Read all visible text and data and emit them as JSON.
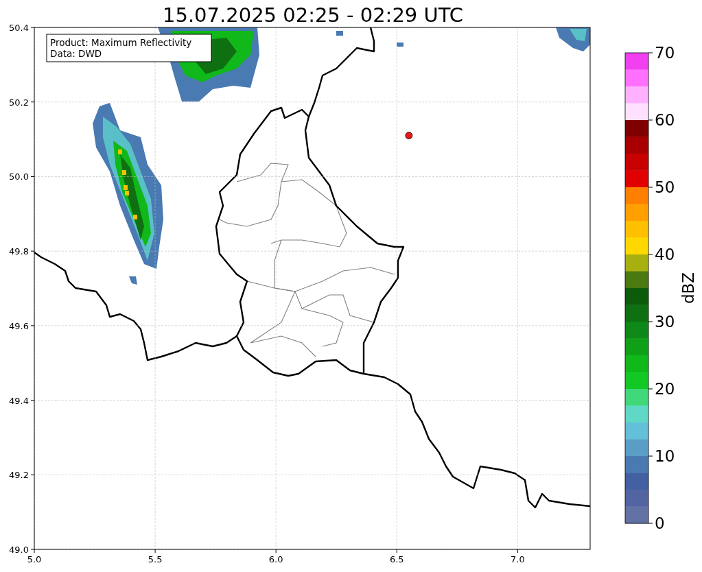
{
  "chart": {
    "info": [
      "Product: Maximum Reflectivity",
      "Data: DWD"
    ],
    "chart_data": {
      "type": "scatter",
      "title": "15.07.2025 02:25 - 02:29 UTC",
      "xlim": [
        5,
        7.3
      ],
      "ylim": [
        49,
        50.4
      ],
      "xticks": [
        {
          "value": 5,
          "label": "5.0"
        },
        {
          "value": 5.5,
          "label": "5.5"
        },
        {
          "value": 6,
          "label": "6.0"
        },
        {
          "value": 6.5,
          "label": "6.5"
        },
        {
          "value": 7,
          "label": "7.0"
        }
      ],
      "yticks": [
        {
          "value": 49,
          "label": "49.0"
        },
        {
          "value": 49.2,
          "label": "49.2"
        },
        {
          "value": 49.4,
          "label": "49.4"
        },
        {
          "value": 49.6,
          "label": "49.6"
        },
        {
          "value": 49.8,
          "label": "49.8"
        },
        {
          "value": 50,
          "label": "50.0"
        },
        {
          "value": 50.2,
          "label": "50.2"
        },
        {
          "value": 50.4,
          "label": "50.4"
        }
      ],
      "x": [
        6.55
      ],
      "grid": true,
      "series": [
        {
          "color": "#e41a1c",
          "values": [
            50.11
          ]
        }
      ]
    }
  },
  "colorbar": {
    "label": "dBZ",
    "ticks": [
      "70",
      "60",
      "50",
      "40",
      "30",
      "20",
      "10",
      "0"
    ],
    "bins": [
      {
        "color": "#f040f0"
      },
      {
        "color": "#ff70ff"
      },
      {
        "color": "#ffb0ff"
      },
      {
        "color": "#ffe0ff"
      },
      {
        "color": "#800000"
      },
      {
        "color": "#a80000"
      },
      {
        "color": "#c80000"
      },
      {
        "color": "#e00000"
      },
      {
        "color": "#ff8000"
      },
      {
        "color": "#ffa000"
      },
      {
        "color": "#ffc000"
      },
      {
        "color": "#ffd800"
      },
      {
        "color": "#a8b010"
      },
      {
        "color": "#4a7a10"
      },
      {
        "color": "#0c5c0c"
      },
      {
        "color": "#0e7010"
      },
      {
        "color": "#0e8818"
      },
      {
        "color": "#10a018"
      },
      {
        "color": "#10b81a"
      },
      {
        "color": "#12c822"
      },
      {
        "color": "#40d878"
      },
      {
        "color": "#60d8c6"
      },
      {
        "color": "#62c0d8"
      },
      {
        "color": "#5a9ec8"
      },
      {
        "color": "#4a7ab2"
      },
      {
        "color": "#4260a2"
      },
      {
        "color": "#5264a2"
      },
      {
        "color": "#6272a4"
      }
    ]
  }
}
